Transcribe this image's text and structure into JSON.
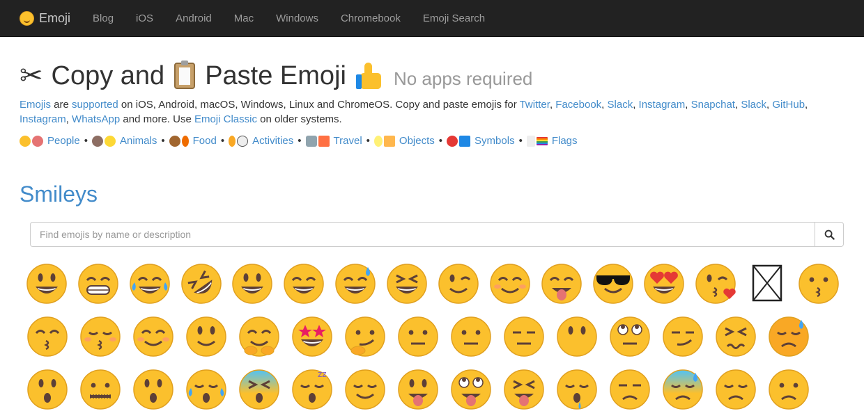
{
  "nav": {
    "brand": "Emoji",
    "links": [
      "Blog",
      "iOS",
      "Android",
      "Mac",
      "Windows",
      "Chromebook",
      "Emoji Search"
    ]
  },
  "header": {
    "title_part1": "Copy and",
    "title_part2": "Paste Emoji",
    "subtitle": "No apps required"
  },
  "intro": {
    "emojis": "Emojis",
    "are": " are ",
    "supported": "supported",
    "text1": " on iOS, Android, macOS, Windows, Linux and ChromeOS. Copy and paste emojis for ",
    "twitter": "Twitter",
    "comma": ", ",
    "facebook": "Facebook",
    "slack": "Slack",
    "instagram": "Instagram",
    "snapchat": "Snapchat",
    "github": "GitHub",
    "whatsapp": "WhatsApp",
    "text2": " and more. Use ",
    "classic": "Emoji Classic",
    "text3": " on older systems."
  },
  "categories": [
    "People",
    "Animals",
    "Food",
    "Activities",
    "Travel",
    "Objects",
    "Symbols",
    "Flags"
  ],
  "section": {
    "title": "Smileys"
  },
  "search": {
    "placeholder": "Find emojis by name or description"
  },
  "emoji_grid": [
    [
      "grinning-face",
      "beaming-face",
      "tears-of-joy-face",
      "rolling-on-floor-laughing-face",
      "grinning-big-eyes-face",
      "grinning-smiling-eyes-face",
      "grinning-sweat-face",
      "squinting-face",
      "winking-face",
      "smiling-eyes-face",
      "savoring-food-face",
      "sunglasses-face",
      "heart-eyes-face",
      "blowing-kiss-face",
      "missing-glyph",
      "kissing-face"
    ],
    [
      "kissing-smiling-eyes-face",
      "kissing-closed-eyes-face",
      "smiling-blush-face",
      "slightly-smiling-face",
      "hugging-face",
      "star-struck-face",
      "thinking-face",
      "raised-eyebrow-face",
      "neutral-face",
      "expressionless-face",
      "no-mouth-face",
      "rolling-eyes-face",
      "smirking-face",
      "persevering-face",
      "disappointed-relieved-face"
    ],
    [
      "open-mouth-face",
      "zipper-mouth-face",
      "hushed-face",
      "sleepy-face",
      "tired-face",
      "sleeping-face",
      "relieved-face",
      "tongue-face",
      "winking-tongue-face",
      "squinting-tongue-face",
      "drooling-face",
      "unamused-face",
      "downcast-sweat-face",
      "pensive-face",
      "confused-face"
    ]
  ],
  "colors": {
    "navbar": "#222222",
    "link": "#428bca",
    "face": "#fbc02d"
  }
}
